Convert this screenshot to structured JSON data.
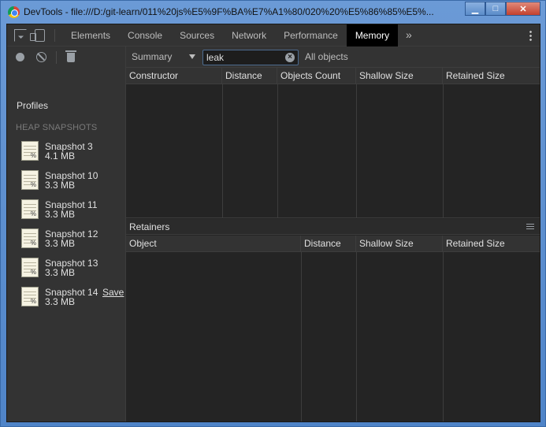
{
  "window": {
    "title": "DevTools - file:///D:/git-learn/011%20js%E5%9F%BA%E7%A1%80/020%20%E5%86%85%E5%...",
    "controls": {
      "minimize": "▁",
      "maximize": "□",
      "close": "✕"
    }
  },
  "toolbar": {
    "tabs": [
      "Elements",
      "Console",
      "Sources",
      "Network",
      "Performance",
      "Memory"
    ],
    "active_tab": "Memory",
    "more": "»"
  },
  "sidebar": {
    "profiles_label": "Profiles",
    "section_label": "HEAP SNAPSHOTS",
    "snapshots": [
      {
        "name": "Snapshot 3",
        "size": "4.1 MB"
      },
      {
        "name": "Snapshot 10",
        "size": "3.3 MB"
      },
      {
        "name": "Snapshot 11",
        "size": "3.3 MB"
      },
      {
        "name": "Snapshot 12",
        "size": "3.3 MB"
      },
      {
        "name": "Snapshot 13",
        "size": "3.3 MB"
      },
      {
        "name": "Snapshot 14",
        "size": "3.3 MB",
        "save_label": "Save"
      }
    ],
    "snapshot_icon_glyph": "%"
  },
  "filterbar": {
    "view": "Summary",
    "filter_value": "leak",
    "class_filter": "All objects"
  },
  "constructor_grid": {
    "columns": [
      "Constructor",
      "Distance",
      "Objects Count",
      "Shallow Size",
      "Retained Size"
    ]
  },
  "retainers": {
    "label": "Retainers",
    "columns": [
      "Object",
      "Distance",
      "Shallow Size",
      "Retained Size"
    ]
  }
}
